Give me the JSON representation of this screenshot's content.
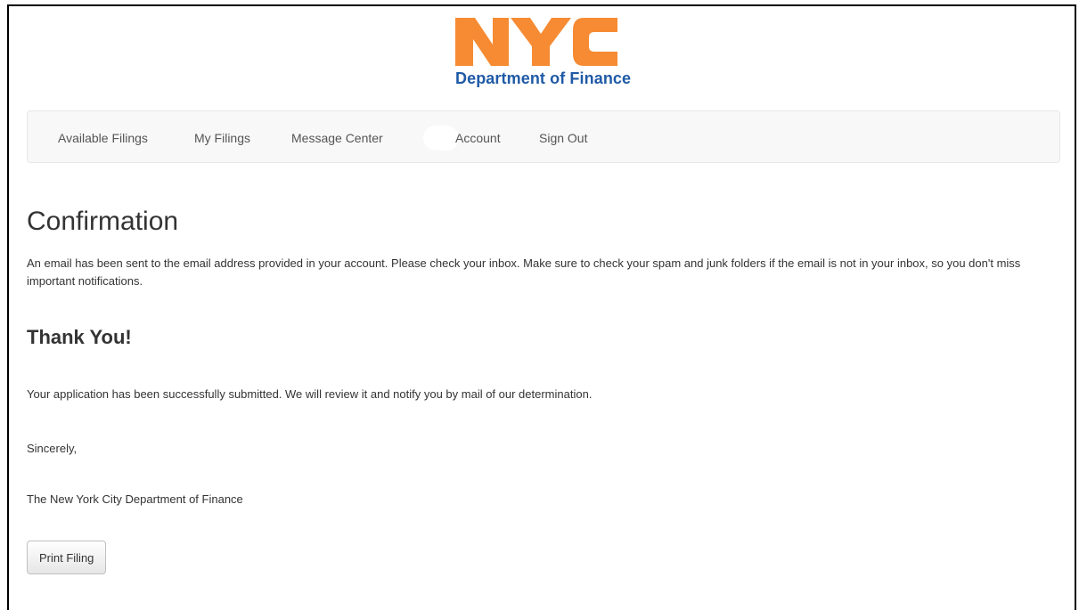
{
  "header": {
    "logo_mark_text": "NYC",
    "logo_subtitle": "Department of Finance",
    "brand_colors": {
      "nyc_orange": "#f68b33",
      "finance_blue": "#1f5aa6"
    }
  },
  "nav": {
    "items": [
      {
        "label": "Available Filings"
      },
      {
        "label": "My Filings"
      },
      {
        "label": "Message Center"
      },
      {
        "label": "Account"
      },
      {
        "label": "Sign Out"
      }
    ]
  },
  "main": {
    "title": "Confirmation",
    "email_note": "An email has been sent to the email address provided in your account. Please check your inbox. Make sure to check your spam and junk folders if the email is not in your inbox, so you don't miss important notifications.",
    "thank_you_heading": "Thank You!",
    "submitted_text": "Your application has been successfully submitted. We will review it and notify you by mail of our determination.",
    "closing": "Sincerely,",
    "signature": "The New York City Department of Finance",
    "print_button_label": "Print Filing"
  }
}
